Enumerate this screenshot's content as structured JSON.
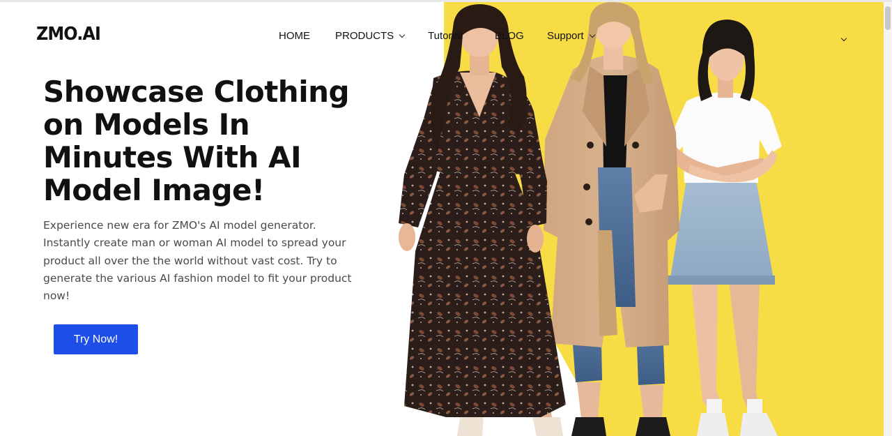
{
  "brand": {
    "logo_text": "ZMO.AI"
  },
  "nav": {
    "home": "HOME",
    "products": "PRODUCTS",
    "tutorial": "Tutorial",
    "blog": "BLOG",
    "support": "Support"
  },
  "hero": {
    "headline": "Showcase Clothing on Models In Minutes With AI Model Image!",
    "description": "Experience new era for ZMO's AI model generator. Instantly create man or woman AI model to spread your product all over the the world without vast cost. Try to generate the various AI fashion model to fit your product now!",
    "cta_label": "Try Now!"
  },
  "colors": {
    "accent_yellow": "#f8dc45",
    "cta_blue": "#1d4ee8",
    "text_dark": "#111111",
    "text_body": "#4a4a4a"
  }
}
